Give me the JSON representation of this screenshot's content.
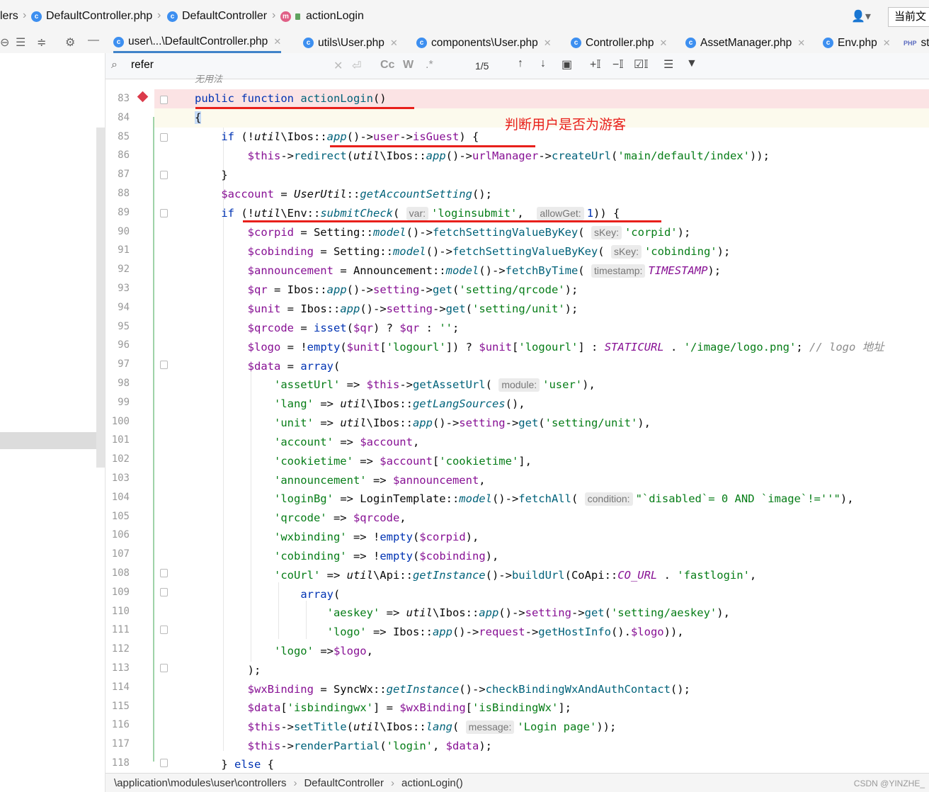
{
  "breadcrumb": {
    "items": [
      "lers",
      "DefaultController.php",
      "DefaultController",
      "actionLogin"
    ],
    "right_button": "当前文"
  },
  "tabs": [
    {
      "label": "user\\...\\DefaultController.php",
      "active": true
    },
    {
      "label": "utils\\User.php"
    },
    {
      "label": "components\\User.php"
    },
    {
      "label": "Controller.php"
    },
    {
      "label": "AssetManager.php"
    },
    {
      "label": "Env.php"
    },
    {
      "label": "st"
    }
  ],
  "search": {
    "query": "refer",
    "match_count": "1/5",
    "case_label": "Cc",
    "word_label": "W",
    "regex_label": ".*"
  },
  "annotation": "判断用户是否为游客",
  "code_top_comment": "无用法",
  "line_numbers": [
    "83",
    "84",
    "85",
    "86",
    "87",
    "88",
    "89",
    "90",
    "91",
    "92",
    "93",
    "94",
    "95",
    "96",
    "97",
    "98",
    "99",
    "100",
    "101",
    "102",
    "103",
    "104",
    "105",
    "106",
    "107",
    "108",
    "109",
    "110",
    "111",
    "112",
    "113",
    "114",
    "115",
    "116",
    "117",
    "118"
  ],
  "hints": {
    "var": "var:",
    "allowGet": "allowGet:",
    "sKey": "sKey:",
    "timestamp": "timestamp:",
    "module": "module:",
    "condition": "condition:",
    "message": "message:"
  },
  "statusbar": {
    "path": "\\application\\modules\\user\\controllers",
    "class": "DefaultController",
    "method": "actionLogin()"
  },
  "watermark": "CSDN @YINZHE_",
  "colors": {
    "keyword": "#0033b3",
    "string": "#067d17",
    "annotation_red": "#e8201b",
    "breakpoint": "#db3b4b"
  }
}
